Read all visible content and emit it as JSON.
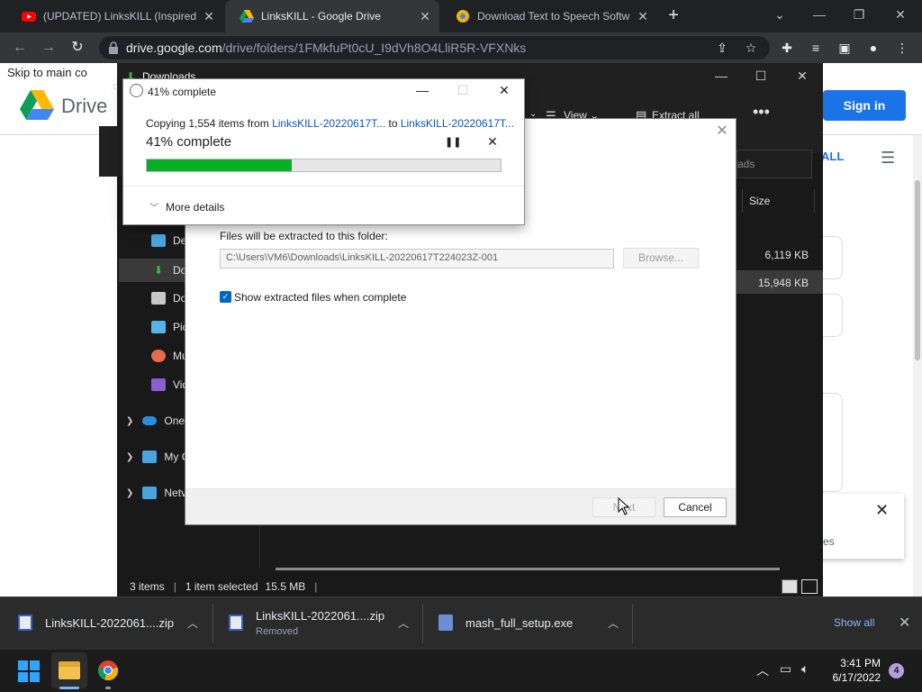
{
  "chrome": {
    "tabs": [
      {
        "title": "(UPDATED) LinksKILL (Inspired By",
        "favicon": "youtube-icon"
      },
      {
        "title": "LinksKILL - Google Drive",
        "favicon": "google-drive-icon"
      },
      {
        "title": "Download Text to Speech Softwa",
        "favicon": "web-page-icon"
      }
    ],
    "url_domain": "drive.google.com",
    "url_path": "/drive/folders/1FMkfuPt0cU_I9dVh8O4LliR5R-VFXNks"
  },
  "drive": {
    "skip_link": "Skip to main co",
    "brand": "Drive",
    "sign_in": "Sign in",
    "download_all_fragment": "ALL",
    "snackbar_fragment": "es"
  },
  "explorer": {
    "title": "Downloads",
    "view_label": "View",
    "extract_all_label": "Extract all",
    "search_placeholder": "ads",
    "size_column": "Size",
    "file_sizes": [
      "6,119 KB",
      "15,948 KB"
    ],
    "nav_items": [
      {
        "label": "Des"
      },
      {
        "label": "Dov"
      },
      {
        "label": "Doc"
      },
      {
        "label": "Pic"
      },
      {
        "label": "Mu"
      },
      {
        "label": "Vid"
      },
      {
        "label": "OneI"
      },
      {
        "label": "My C"
      },
      {
        "label": "Netv"
      }
    ],
    "status": {
      "items": "3 items",
      "selected": "1 item selected",
      "size": "15.5 MB"
    }
  },
  "wizard": {
    "folder_label": "Files will be extracted to this folder:",
    "path": "C:\\Users\\VM6\\Downloads\\LinksKILL-20220617T224023Z-001",
    "browse": "Browse...",
    "show_files_label": "Show extracted files when complete",
    "next": "Next",
    "cancel": "Cancel"
  },
  "progress": {
    "title": "41% complete",
    "copying_prefix": "Copying 1,554 items from ",
    "source": "LinksKILL-20220617T...",
    "to_word": " to ",
    "destination": "LinksKILL-20220617T...",
    "status_big": "41% complete",
    "percent": 41,
    "more_details": "More details"
  },
  "downloads": [
    {
      "name": "LinksKILL-2022061....zip",
      "status": ""
    },
    {
      "name": "LinksKILL-2022061....zip",
      "status": "Removed"
    },
    {
      "name": "mash_full_setup.exe",
      "status": ""
    }
  ],
  "download_bar": {
    "show_all": "Show all"
  },
  "taskbar": {
    "time": "3:41 PM",
    "date": "6/17/2022",
    "notifications": "4"
  }
}
